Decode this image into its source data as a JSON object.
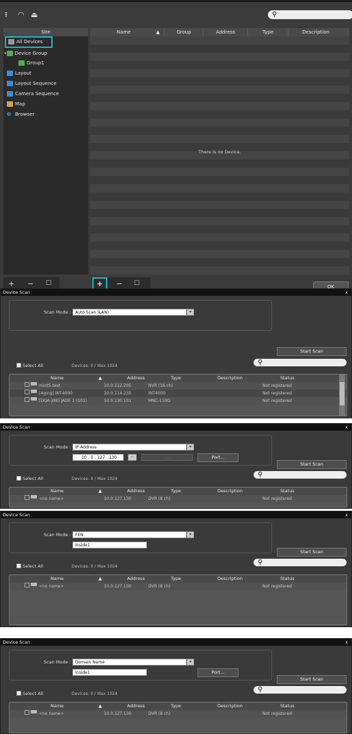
{
  "main": {
    "site_header": "Site",
    "search_placeholder": "",
    "sidebar": [
      {
        "label": "All Devices",
        "icon": "all-devices-icon"
      },
      {
        "label": "Device Group",
        "icon": "device-group-icon"
      },
      {
        "label": "Group1",
        "icon": "group-icon"
      },
      {
        "label": "Layout",
        "icon": "layout-icon"
      },
      {
        "label": "Layout Sequence",
        "icon": "layout-sequence-icon"
      },
      {
        "label": "Camera Sequence",
        "icon": "camera-sequence-icon"
      },
      {
        "label": "Map",
        "icon": "map-icon"
      },
      {
        "label": "Browser",
        "icon": "browser-icon"
      }
    ],
    "columns": [
      "Name",
      "Group",
      "Address",
      "Type",
      "Description"
    ],
    "empty_text": "There is no Device.",
    "ok_label": "OK"
  },
  "dialogs": {
    "title": "Device Scan",
    "scan_mode_label": "Scan Mode :",
    "start_scan": "Start Scan",
    "select_all": "Select All",
    "devices_count": "Devices: 0 / Max 1024",
    "port": "Port...",
    "columns": [
      "Name",
      "Address",
      "Type",
      "Description",
      "Status"
    ],
    "d1": {
      "mode": "Auto Scan (LAN)",
      "rows": [
        {
          "name": "mint5-test",
          "address": "10.0.112.205",
          "type": "NVR (16 ch)",
          "status": "Not registered"
        },
        {
          "name": "[Aging] INT4000",
          "address": "10.0.114.235",
          "type": "INT4000",
          "status": "Not registered"
        },
        {
          "name": "[DQA-JINI] JADE 1 (101)",
          "address": "10.0.130.101",
          "type": "MNC-110D",
          "status": "Not registered"
        }
      ]
    },
    "d2": {
      "mode": "IP Address",
      "ip": "10  .  0  . 127 . 130",
      "tilde": "~",
      "ip2": ".  .  .",
      "rows": [
        {
          "name": "<no name>",
          "address": "10.0.127.130",
          "type": "DVR (8 ch)",
          "status": "Not registered"
        }
      ]
    },
    "d3": {
      "mode": "FEN",
      "value": "Inside1",
      "rows": [
        {
          "name": "<no name>",
          "address": "10.0.127.130",
          "type": "DVR (8 ch)",
          "status": "Not registered"
        }
      ]
    },
    "d4": {
      "mode": "Domain Name",
      "value": "Inside1",
      "rows": [
        {
          "name": "<no name>",
          "address": "10.0.127.130",
          "type": "DVR (8 ch)",
          "status": "Not registered"
        }
      ]
    }
  },
  "colors": {
    "highlight": "#21b3c6"
  }
}
